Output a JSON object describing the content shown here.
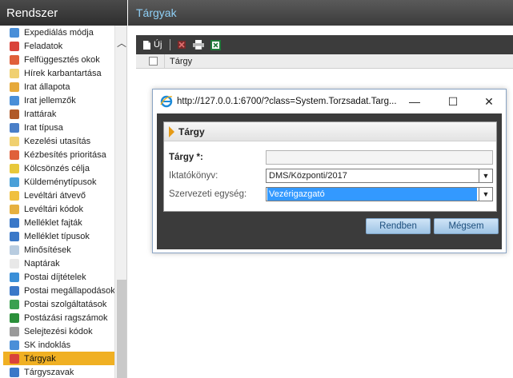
{
  "header": {
    "left_title": "Rendszer",
    "main_title": "Tárgyak"
  },
  "sidebar": {
    "items": [
      {
        "label": "Expediálás módja",
        "icon": "arrows-icon",
        "color": "#4a8fd8",
        "active": false
      },
      {
        "label": "Feladatok",
        "icon": "tasks-icon",
        "color": "#d9433a",
        "active": false
      },
      {
        "label": "Felfüggesztés okok",
        "icon": "suspend-icon",
        "color": "#e0603a",
        "active": false
      },
      {
        "label": "Hírek karbantartása",
        "icon": "news-icon",
        "color": "#f0d070",
        "active": false
      },
      {
        "label": "Irat állapota",
        "icon": "document-state-icon",
        "color": "#e6a93a",
        "active": false
      },
      {
        "label": "Irat jellemzők",
        "icon": "document-props-icon",
        "color": "#4a8fd8",
        "active": false
      },
      {
        "label": "Irattárak",
        "icon": "archive-icon",
        "color": "#b05a2a",
        "active": false
      },
      {
        "label": "Irat típusa",
        "icon": "document-type-icon",
        "color": "#4a7fc8",
        "active": false
      },
      {
        "label": "Kezelési utasítás",
        "icon": "instruction-icon",
        "color": "#f0d070",
        "active": false
      },
      {
        "label": "Kézbesítés prioritása",
        "icon": "priority-icon",
        "color": "#e0603a",
        "active": false
      },
      {
        "label": "Kölcsönzés célja",
        "icon": "lending-icon",
        "color": "#e8c83a",
        "active": false
      },
      {
        "label": "Küldeménytípusok",
        "icon": "globe-icon",
        "color": "#4aa0d8",
        "active": false
      },
      {
        "label": "Levéltári átvevő",
        "icon": "receiver-icon",
        "color": "#f0c040",
        "active": false
      },
      {
        "label": "Levéltári kódok",
        "icon": "code-icon",
        "color": "#e6b040",
        "active": false
      },
      {
        "label": "Melléklet fajták",
        "icon": "attachment-icon",
        "color": "#3a78c8",
        "active": false
      },
      {
        "label": "Melléklet típusok",
        "icon": "attachment-type-icon",
        "color": "#3a78c8",
        "active": false
      },
      {
        "label": "Minősítések",
        "icon": "qualification-icon",
        "color": "#b8cce0",
        "active": false
      },
      {
        "label": "Naptárak",
        "icon": "calendar-icon",
        "color": "#e8e8e8",
        "active": false
      },
      {
        "label": "Postai díjtételek",
        "icon": "postal-fee-icon",
        "color": "#3a8fd8",
        "active": false
      },
      {
        "label": "Postai megállapodások",
        "icon": "postal-agreement-icon",
        "color": "#3a78c8",
        "active": false
      },
      {
        "label": "Postai szolgáltatások",
        "icon": "postal-service-icon",
        "color": "#3aa050",
        "active": false
      },
      {
        "label": "Postázási ragszámok",
        "icon": "postal-number-icon",
        "color": "#2a8f3a",
        "active": false
      },
      {
        "label": "Selejtezési kódok",
        "icon": "trash-icon",
        "color": "#9a9a9a",
        "active": false
      },
      {
        "label": "SK indoklás",
        "icon": "sk-reason-icon",
        "color": "#4a8fd8",
        "active": false
      },
      {
        "label": "Tárgyak",
        "icon": "subjects-icon",
        "color": "#d9433a",
        "active": true
      },
      {
        "label": "Tárgyszavak",
        "icon": "keywords-icon",
        "color": "#3a78c8",
        "active": false
      }
    ]
  },
  "toolbar": {
    "new_label": "Új"
  },
  "grid": {
    "column_subject": "Tárgy"
  },
  "window": {
    "url": "http://127.0.0.1:6700/?class=System.Torzsadat.Targ...",
    "minimize": "—",
    "maximize": "☐",
    "close": "✕"
  },
  "form": {
    "panel_title": "Tárgy",
    "subject_label": "Tárgy *:",
    "subject_value": "",
    "register_label": "Iktatókönyv:",
    "register_value": "DMS/Központi/2017",
    "unit_label": "Szervezeti egység:",
    "unit_value": "Vezérigazgató",
    "ok_label": "Rendben",
    "cancel_label": "Mégsem"
  },
  "colors": {
    "active_item": "#f0b023",
    "selection": "#3399ff",
    "header_text": "#8fd0f7"
  }
}
